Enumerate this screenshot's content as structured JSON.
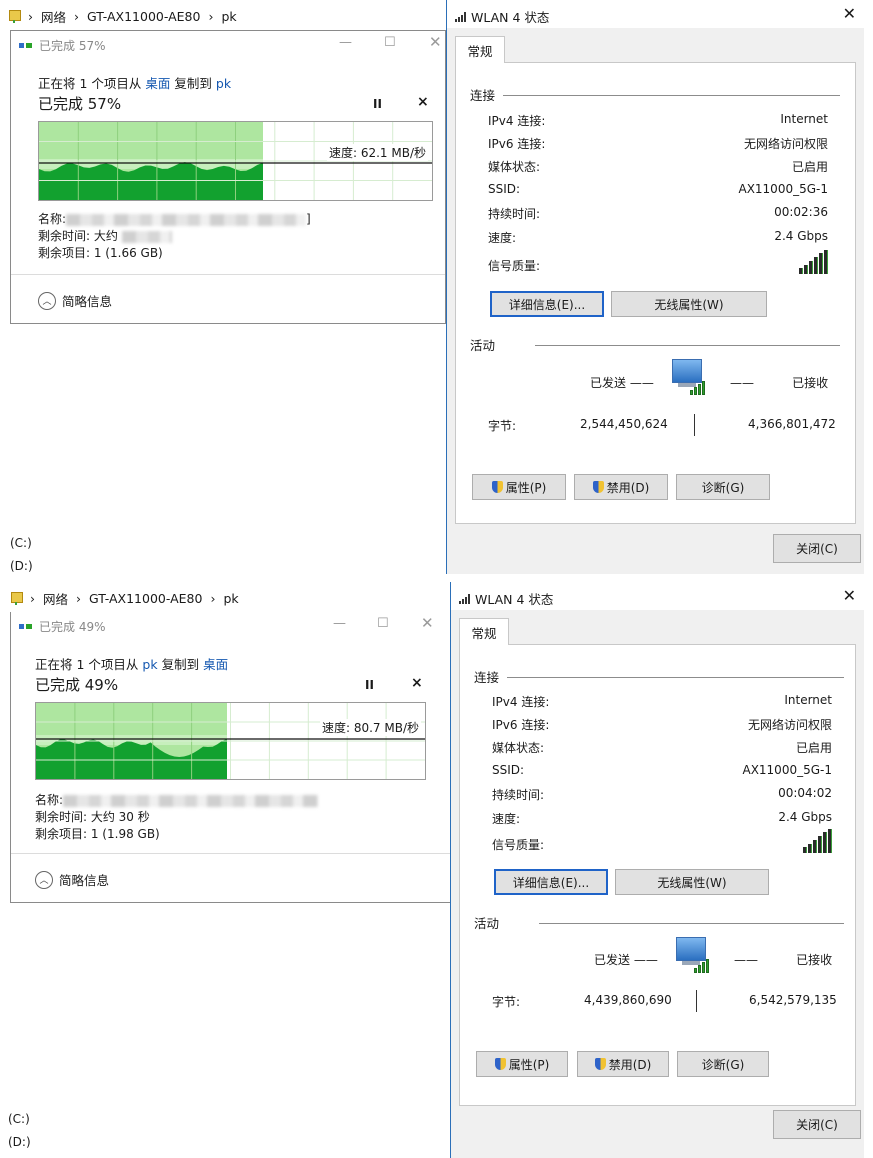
{
  "top": {
    "explorer": {
      "breadcrumb": [
        "›",
        "网络",
        "›",
        "GT-AX11000-AE80",
        "›",
        "pk"
      ],
      "drive_c": "(C:)",
      "drive_d": "(D:)"
    },
    "copy": {
      "title": "已完成 57%",
      "line_prefix": "正在将 1 个项目从",
      "from": "桌面",
      "line_mid": "复制到",
      "to": "pk",
      "progress_text": "已完成 57%",
      "progress": 0.57,
      "speed": "速度: 62.1 MB/秒",
      "name_label": "名称:",
      "name_tail": "]",
      "remaining_time_label": "剩余时间:",
      "remaining_time_value": "大约",
      "remaining_items": "剩余项目: 1 (1.66 GB)",
      "less_details": "简略信息",
      "pause": "II",
      "cancel": "×"
    },
    "wlan": {
      "title": "WLAN 4 状态",
      "tab": "常规",
      "conn_group": "连接",
      "rows": [
        {
          "k": "IPv4 连接:",
          "v": "Internet"
        },
        {
          "k": "IPv6 连接:",
          "v": "无网络访问权限"
        },
        {
          "k": "媒体状态:",
          "v": "已启用"
        },
        {
          "k": "SSID:",
          "v": "AX11000_5G-1"
        },
        {
          "k": "持续时间:",
          "v": "00:02:36"
        },
        {
          "k": "速度:",
          "v": "2.4 Gbps"
        }
      ],
      "signal_label": "信号质量:",
      "details_btn": "详细信息(E)...",
      "wireless_btn": "无线属性(W)",
      "activity_group": "活动",
      "sent": "已发送",
      "recv": "已接收",
      "bytes_label": "字节:",
      "bytes_sent": "2,544,450,624",
      "bytes_recv": "4,366,801,472",
      "props_btn": "属性(P)",
      "disable_btn": "禁用(D)",
      "diag_btn": "诊断(G)",
      "close_btn": "关闭(C)"
    }
  },
  "bottom": {
    "explorer": {
      "breadcrumb": [
        "›",
        "网络",
        "›",
        "GT-AX11000-AE80",
        "›",
        "pk"
      ],
      "drive_c": "(C:)",
      "drive_d": "(D:)"
    },
    "copy": {
      "title": "已完成 49%",
      "line_prefix": "正在将 1 个项目从",
      "from": "pk",
      "line_mid": "复制到",
      "to": "桌面",
      "progress_text": "已完成 49%",
      "progress": 0.49,
      "speed": "速度: 80.7 MB/秒",
      "name_label": "名称:",
      "remaining_time": "剩余时间: 大约 30 秒",
      "remaining_items": "剩余项目: 1 (1.98 GB)",
      "less_details": "简略信息",
      "pause": "II",
      "cancel": "×"
    },
    "wlan": {
      "title": "WLAN 4 状态",
      "tab": "常规",
      "conn_group": "连接",
      "rows": [
        {
          "k": "IPv4 连接:",
          "v": "Internet"
        },
        {
          "k": "IPv6 连接:",
          "v": "无网络访问权限"
        },
        {
          "k": "媒体状态:",
          "v": "已启用"
        },
        {
          "k": "SSID:",
          "v": "AX11000_5G-1"
        },
        {
          "k": "持续时间:",
          "v": "00:04:02"
        },
        {
          "k": "速度:",
          "v": "2.4 Gbps"
        }
      ],
      "signal_label": "信号质量:",
      "details_btn": "详细信息(E)...",
      "wireless_btn": "无线属性(W)",
      "activity_group": "活动",
      "sent": "已发送",
      "recv": "已接收",
      "bytes_label": "字节:",
      "bytes_sent": "4,439,860,690",
      "bytes_recv": "6,542,579,135",
      "props_btn": "属性(P)",
      "disable_btn": "禁用(D)",
      "diag_btn": "诊断(G)",
      "close_btn": "关闭(C)"
    }
  },
  "colors": {
    "graph_fill": "#12a12f",
    "graph_bg": "#aee6a0",
    "link": "#1558b0",
    "accent": "#2b6fb8"
  }
}
